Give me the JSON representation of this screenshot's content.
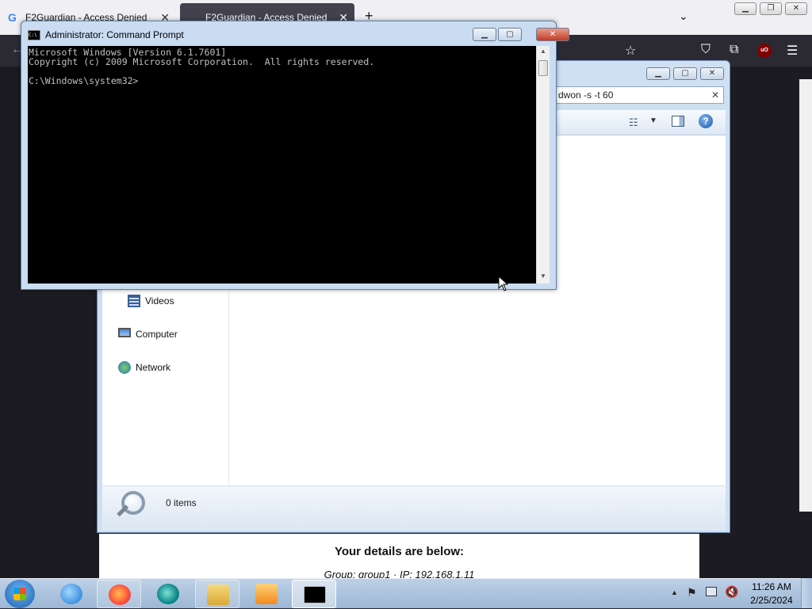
{
  "browser": {
    "tabs": [
      {
        "label": "F2Guardian - Access Denied",
        "favicon": "G"
      },
      {
        "label": "F2Guardian - Access Denied"
      }
    ],
    "new_tab_glyph": "+",
    "page": {
      "details_heading": "Your details are below:",
      "details_line": "Group: group1 · IP: 192.168.1.11"
    }
  },
  "explorer": {
    "search_text": "dwon -s -t 60",
    "nav_items": [
      "Videos",
      "Computer",
      "Network"
    ],
    "status_count": "0 items"
  },
  "cmd": {
    "title": "Administrator: Command Prompt",
    "icon_text": "C:\\",
    "lines": [
      "Microsoft Windows [Version 6.1.7601]",
      "Copyright (c) 2009 Microsoft Corporation.  All rights reserved.",
      "",
      "C:\\Windows\\system32>"
    ]
  },
  "taskbar": {
    "time": "11:26 AM",
    "date": "2/25/2024",
    "items": [
      "internet-explorer",
      "firefox",
      "browser-app",
      "windows-explorer",
      "media-player",
      "command-prompt"
    ]
  },
  "colors": {
    "console_bg": "#000000",
    "console_fg": "#c0c0c0",
    "close_red": "#c43c25",
    "taskbar": "#9db7d5"
  }
}
